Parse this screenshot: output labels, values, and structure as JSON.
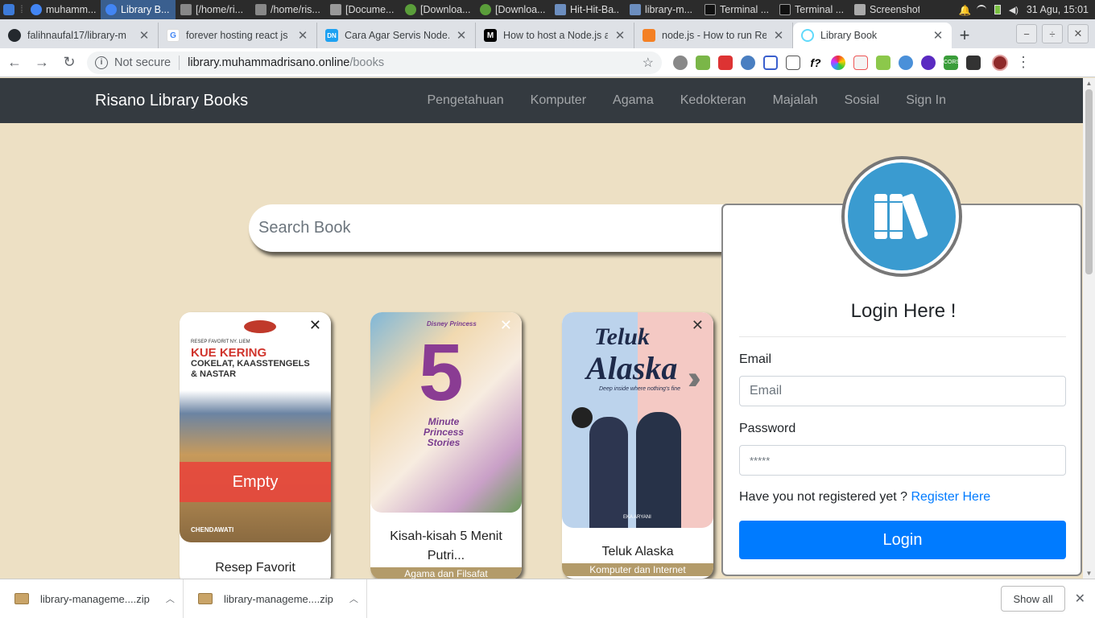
{
  "os": {
    "tasks": [
      {
        "label": "muhamm...",
        "color": "#4285f4"
      },
      {
        "label": "Library B...",
        "color": "#4285f4",
        "active": true
      },
      {
        "label": "[/home/ri...",
        "color": "#888"
      },
      {
        "label": "/home/ris...",
        "color": "#888"
      },
      {
        "label": "[Docume...",
        "color": "#999"
      },
      {
        "label": "[Downloa...",
        "color": "#5a9e3a"
      },
      {
        "label": "[Downloa...",
        "color": "#5a9e3a"
      },
      {
        "label": "Hit-Hit-Ba...",
        "color": "#6c8ebf"
      },
      {
        "label": "library-m...",
        "color": "#6c8ebf"
      },
      {
        "label": "Terminal ...",
        "color": "#222"
      },
      {
        "label": "Terminal ...",
        "color": "#222"
      },
      {
        "label": "Screenshot",
        "color": "#aaa"
      }
    ],
    "clock": "31 Agu, 15:01"
  },
  "tabs": [
    {
      "label": "falihnaufal17/library-m",
      "fav_color": "#24292e",
      "fav_text": ""
    },
    {
      "label": "forever hosting react js",
      "fav_color": "#fff",
      "fav_text": "G"
    },
    {
      "label": "Cara Agar Servis Node.",
      "fav_color": "#1da1f2",
      "fav_text": "DN"
    },
    {
      "label": "How to host a Node.js a",
      "fav_color": "#000",
      "fav_text": "M"
    },
    {
      "label": "node.js - How to run Re",
      "fav_color": "#f48024",
      "fav_text": ""
    },
    {
      "label": "Library Book",
      "fav_color": "#61dafb",
      "fav_text": "",
      "active": true
    }
  ],
  "omnibox": {
    "security": "Not secure",
    "host": "library.muhammadrisano.online",
    "path": "/books"
  },
  "site": {
    "brand": "Risano Library Books",
    "nav": [
      "Pengetahuan",
      "Komputer",
      "Agama",
      "Kedokteran",
      "Majalah",
      "Sosial",
      "Sign In"
    ]
  },
  "search": {
    "placeholder": "Search Book"
  },
  "books": [
    {
      "title": "Resep Favorit",
      "category": "",
      "status": "Empty",
      "cover_lines": [
        "RESEP FAVORIT NY. LIEM",
        "KUE KERING",
        "COKELAT, KAASSTENGELS",
        "& NASTAR",
        "CHENDAWATI"
      ]
    },
    {
      "title": "Kisah-kisah 5 Menit Putri...",
      "category": "Agama dan Filsafat",
      "cover_lines": [
        "Disney Princess",
        "5",
        "Minute Princess Stories"
      ]
    },
    {
      "title": "Teluk Alaska",
      "category": "Komputer dan Internet",
      "cover_lines": [
        "Teluk",
        "Alaska",
        "Deep inside where nothing's fine",
        "EKA ARYANI"
      ]
    }
  ],
  "login": {
    "title": "Login Here !",
    "email_label": "Email",
    "email_placeholder": "Email",
    "password_label": "Password",
    "password_placeholder": "*****",
    "register_prompt": "Have you not registered yet ?",
    "register_link": "Register Here",
    "button": "Login"
  },
  "downloads": {
    "items": [
      "library-manageme....zip",
      "library-manageme....zip"
    ],
    "show_all": "Show all"
  },
  "colors": {
    "navbar": "#343a40",
    "page_bg": "#ede0c4",
    "primary": "#007bff",
    "logo": "#3a9bd0"
  }
}
